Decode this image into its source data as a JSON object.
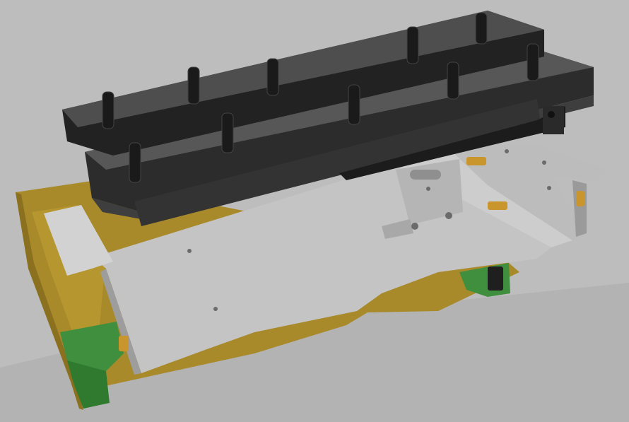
{
  "scene": {
    "description_visible_text": [],
    "colors": {
      "background": "#bdbdbd",
      "shadow": "#b0b0b0",
      "wood_base": "#a8892a",
      "wood_edge": "#8e7220",
      "sheet_metal": "#c9c9c9",
      "sheet_metal_dark": "#a9a9a9",
      "rail_black": "#2b2b2b",
      "rail_mid": "#4a4a4a",
      "rail_light": "#6a6a6a",
      "green_block": "#3f8f3f",
      "brass": "#c9962e",
      "switch": "#1e1e1e"
    }
  }
}
